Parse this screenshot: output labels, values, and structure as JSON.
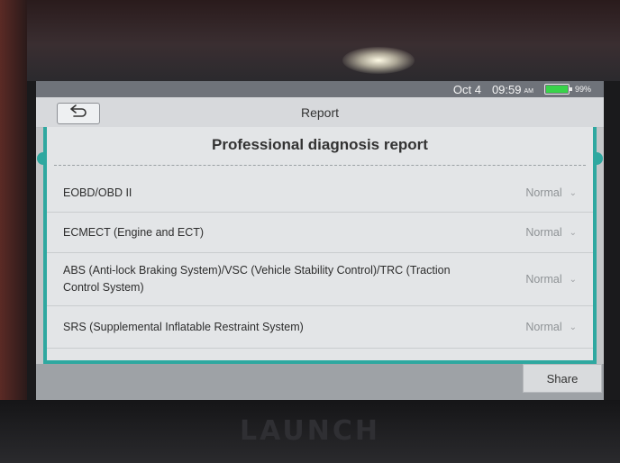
{
  "status": {
    "date": "Oct 4",
    "time": "09:59",
    "ampm": "AM",
    "battery_pct": "99%",
    "battery_level": 0.99
  },
  "header": {
    "title": "Report",
    "back_icon": "back-arrow-icon"
  },
  "report": {
    "heading": "Professional diagnosis report",
    "items": [
      {
        "label": "EOBD/OBD II",
        "status": "Normal"
      },
      {
        "label": "ECMECT (Engine and ECT)",
        "status": "Normal"
      },
      {
        "label": "ABS (Anti-lock Braking System)/VSC (Vehicle Stability Control)/TRC (Traction Control System)",
        "status": "Normal"
      },
      {
        "label": "SRS (Supplemental Inflatable Restraint System)",
        "status": "Normal"
      }
    ]
  },
  "footer": {
    "share_label": "Share"
  },
  "device": {
    "brand": "LAUNCH"
  },
  "colors": {
    "accent": "#2fa8a0",
    "battery": "#39d34a"
  }
}
